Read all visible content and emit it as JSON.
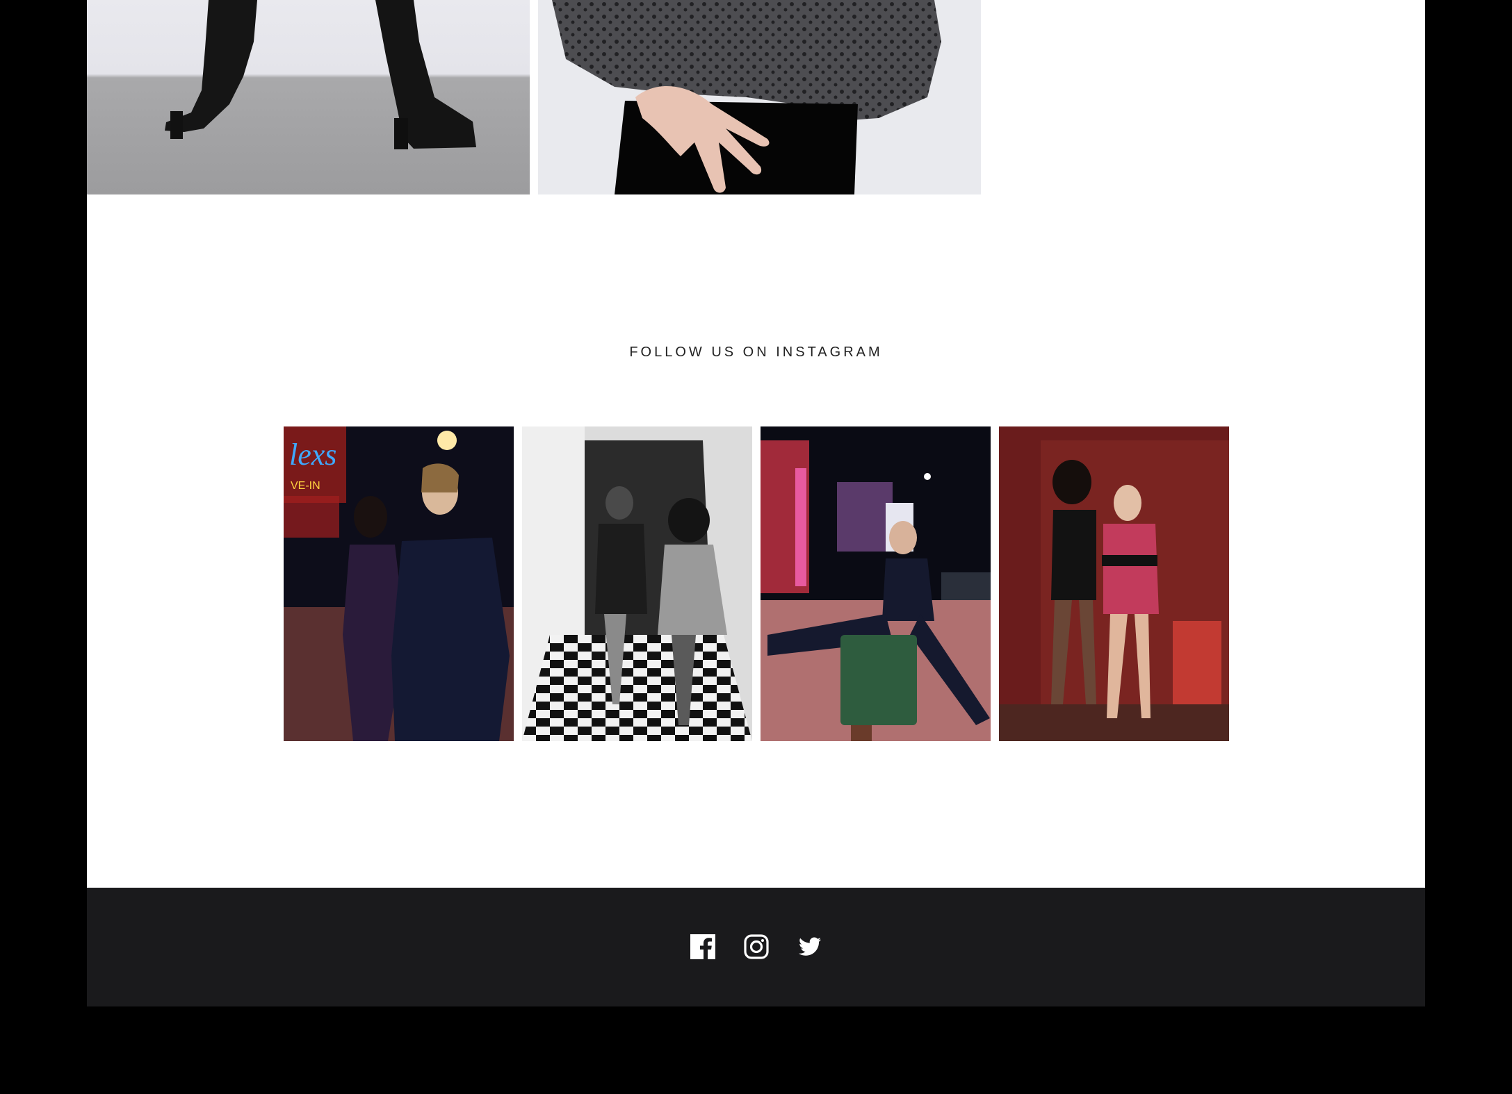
{
  "instagram": {
    "heading": "FOLLOW US ON INSTAGRAM",
    "posts": [
      {
        "alt": "instagram-photo-1"
      },
      {
        "alt": "instagram-photo-2"
      },
      {
        "alt": "instagram-photo-3"
      },
      {
        "alt": "instagram-photo-4"
      }
    ]
  },
  "footer": {
    "social": [
      {
        "icon": "facebook-icon"
      },
      {
        "icon": "instagram-icon"
      },
      {
        "icon": "twitter-icon"
      }
    ]
  },
  "colors": {
    "page_background": "#000000",
    "content_background": "#ffffff",
    "footer_background": "#1a1a1c",
    "heading_text": "#222222",
    "icon": "#ffffff"
  }
}
